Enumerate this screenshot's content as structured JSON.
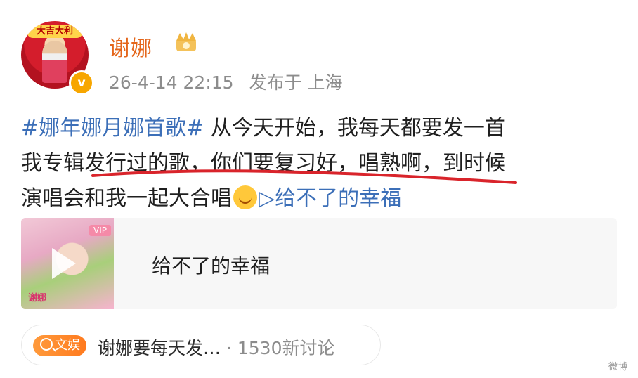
{
  "author": {
    "avatar_banner": "大吉大利",
    "name": "谢娜",
    "verified_badge": "v",
    "vip_icon": "crown-icon"
  },
  "meta": {
    "date": "26-4-14 22:15",
    "location": "发布于 上海"
  },
  "post": {
    "topic": "#娜年娜月娜首歌#",
    "line1": " 从今天开始，我每天都要发一首",
    "line2": "我专辑发行过的歌，你们要复习好，唱熟啊，到时候",
    "line3": "演唱会和我一起大合唱",
    "link_text": "给不了的幸福",
    "highlight_color": "#d9242b"
  },
  "music_card": {
    "title": "给不了的幸福",
    "vip_label": "VIP",
    "cover_text": "谢娜"
  },
  "topic_pill": {
    "badge_label": "文娱",
    "title": "谢娜要每天发…",
    "separator": " · ",
    "discussion": "1530新讨论"
  },
  "watermark": "微博"
}
